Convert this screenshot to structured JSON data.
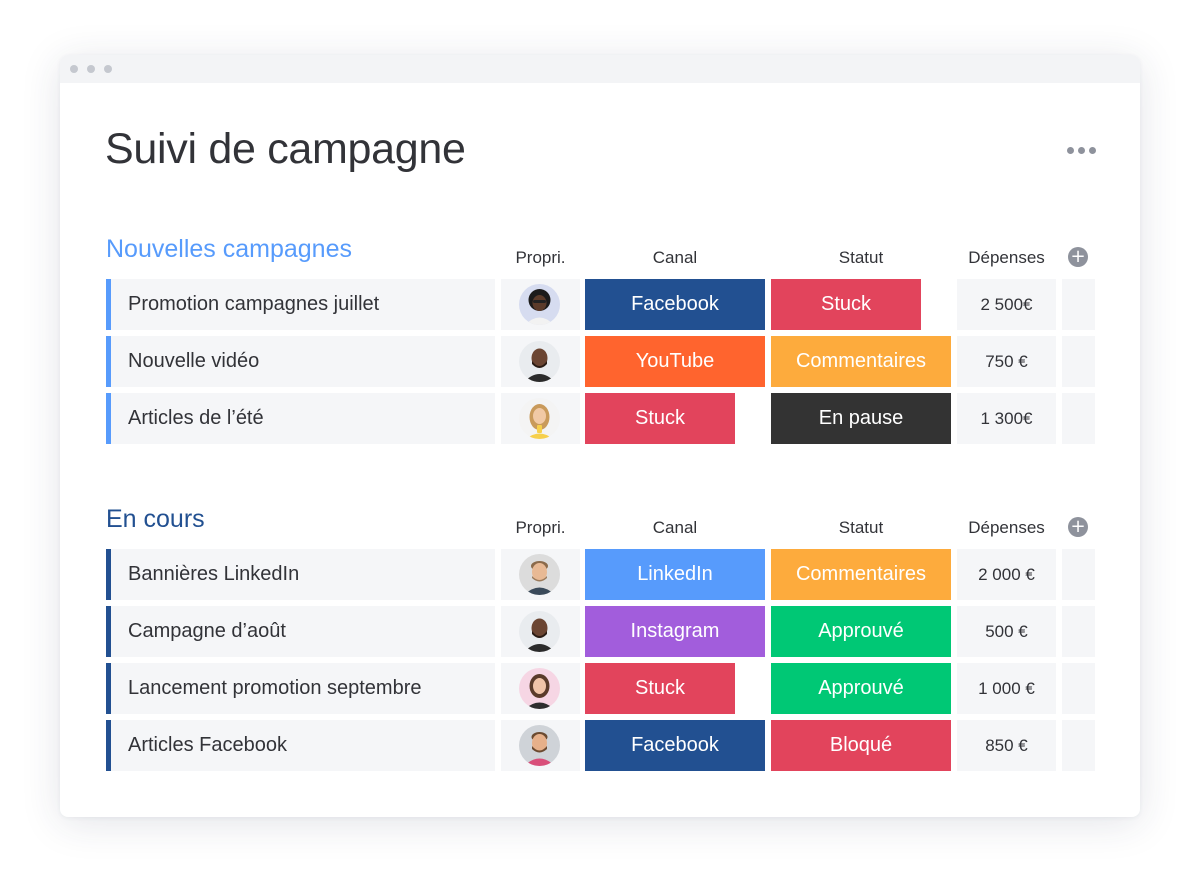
{
  "window": {
    "title": "Suivi de campagne"
  },
  "colors": {
    "group1": "#579bfc",
    "group2": "#225091",
    "Facebook": "#225091",
    "YouTube": "#ff642e",
    "LinkedIn": "#579bfc",
    "Instagram": "#a25ddc",
    "Stuck": "#e2445c",
    "Commentaires": "#fdab3d",
    "En pause": "#333333",
    "Approuvé": "#00c875",
    "Bloqué": "#e2445c"
  },
  "groups": [
    {
      "title": "Nouvelles campagnes",
      "columns": {
        "owner": "Propri.",
        "channel": "Canal",
        "status": "Statut",
        "spend": "Dépenses"
      },
      "rows": [
        {
          "name": "Promotion campagnes juillet",
          "avatar": "person-1",
          "channel": "Facebook",
          "status": "Stuck",
          "spend": "2 500€"
        },
        {
          "name": "Nouvelle vidéo",
          "avatar": "person-2",
          "channel": "YouTube",
          "status": "Commentaires",
          "spend": "750 €"
        },
        {
          "name": "Articles de l’été",
          "avatar": "person-3",
          "channel": "Stuck",
          "status": "En pause",
          "spend": "1 300€"
        }
      ]
    },
    {
      "title": "En cours",
      "columns": {
        "owner": "Propri.",
        "channel": "Canal",
        "status": "Statut",
        "spend": "Dépenses"
      },
      "rows": [
        {
          "name": "Bannières LinkedIn",
          "avatar": "person-4",
          "channel": "LinkedIn",
          "status": "Commentaires",
          "spend": "2 000 €"
        },
        {
          "name": "Campagne d’août",
          "avatar": "person-2",
          "channel": "Instagram",
          "status": "Approuvé",
          "spend": "500 €"
        },
        {
          "name": "Lancement promotion septembre",
          "avatar": "person-5",
          "channel": "Stuck",
          "status": "Approuvé",
          "spend": "1 000 €"
        },
        {
          "name": "Articles Facebook",
          "avatar": "person-6",
          "channel": "Facebook",
          "status": "Bloqué",
          "spend": "850 €"
        }
      ]
    }
  ]
}
